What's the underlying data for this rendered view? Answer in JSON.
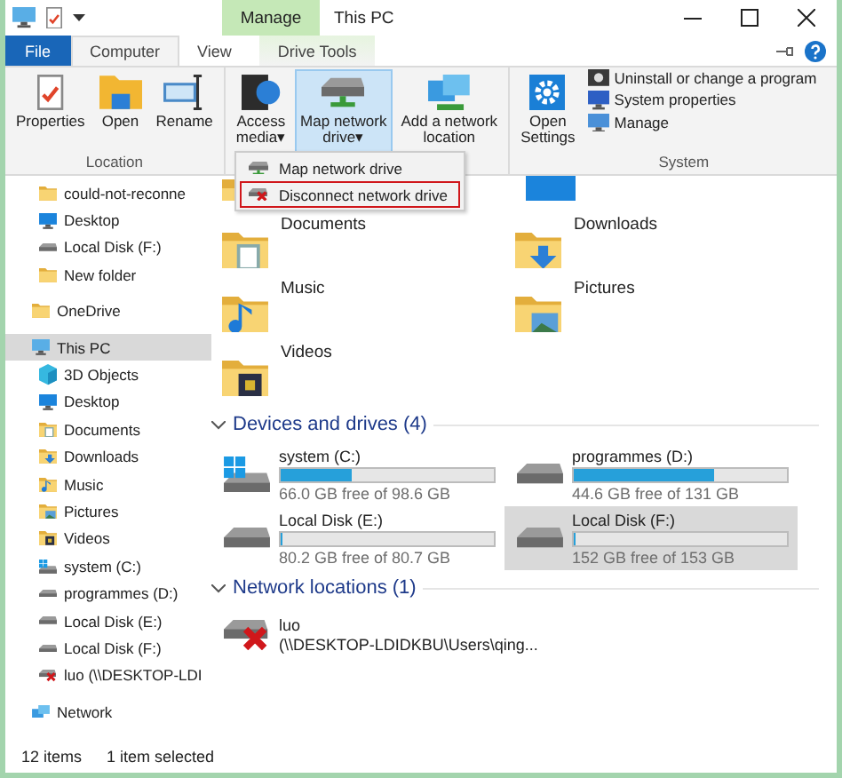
{
  "titlebar": {
    "context_tab": "Manage",
    "title": "This PC"
  },
  "tabs": [
    {
      "label": "File",
      "kind": "file",
      "selected": false
    },
    {
      "label": "Computer",
      "kind": "normal",
      "selected": true
    },
    {
      "label": "View",
      "kind": "normal",
      "selected": false
    },
    {
      "label": "Drive Tools",
      "kind": "context",
      "selected": false
    }
  ],
  "ribbon": {
    "groups": [
      {
        "label": "Location",
        "buttons": [
          {
            "label": "Properties",
            "kind": "properties",
            "pressed": false
          },
          {
            "label": "Open",
            "kind": "open",
            "pressed": false
          },
          {
            "label": "Rename",
            "kind": "rename",
            "pressed": false
          }
        ]
      },
      {
        "buttons": [
          {
            "label": "Access\nmedia",
            "caret": "▾",
            "kind": "media",
            "pressed": false
          },
          {
            "label": "Map network\ndrive",
            "caret": "▾",
            "kind": "map",
            "pressed": true
          },
          {
            "label": "Add a network\nlocation",
            "kind": "addnet",
            "pressed": false
          }
        ]
      },
      {
        "label": "System",
        "buttons": [
          {
            "label": "Open\nSettings",
            "kind": "settings",
            "pressed": false
          }
        ],
        "small_buttons": [
          {
            "label": "Uninstall or change a program",
            "kind": "uninstall"
          },
          {
            "label": "System properties",
            "kind": "sysprops"
          },
          {
            "label": "Manage",
            "kind": "manage"
          }
        ]
      }
    ]
  },
  "menu": {
    "items": [
      {
        "label": "Map network drive",
        "kind": "map",
        "selected": false
      },
      {
        "label": "Disconnect network drive",
        "kind": "disconnect",
        "selected": true
      }
    ]
  },
  "nav": {
    "pinned": [
      {
        "label": "could-not-reconne",
        "kind": "folder",
        "selected": false
      },
      {
        "label": "Desktop",
        "kind": "desktop",
        "selected": false
      },
      {
        "label": "Local Disk (F:)",
        "kind": "drive",
        "selected": false
      },
      {
        "label": "New folder",
        "kind": "folder",
        "selected": false
      }
    ],
    "items": [
      {
        "label": "OneDrive",
        "kind": "folder",
        "selected": false
      },
      {
        "label": "This PC",
        "kind": "pc",
        "selected": true,
        "children": [
          {
            "label": "3D Objects",
            "kind": "cube",
            "selected": false
          },
          {
            "label": "Desktop",
            "kind": "desktop",
            "selected": false
          },
          {
            "label": "Documents",
            "kind": "documents",
            "selected": false
          },
          {
            "label": "Downloads",
            "kind": "downloads",
            "selected": false
          },
          {
            "label": "Music",
            "kind": "music",
            "selected": false
          },
          {
            "label": "Pictures",
            "kind": "pictures",
            "selected": false
          },
          {
            "label": "Videos",
            "kind": "videos",
            "selected": false
          },
          {
            "label": "system (C:)",
            "kind": "system",
            "selected": false
          },
          {
            "label": "programmes (D:)",
            "kind": "drive",
            "selected": false
          },
          {
            "label": "Local Disk (E:)",
            "kind": "drive",
            "selected": false
          },
          {
            "label": "Local Disk (F:)",
            "kind": "drive",
            "selected": false
          },
          {
            "label": "luo (\\\\DESKTOP-LDI",
            "kind": "netdrive",
            "selected": false
          }
        ]
      },
      {
        "label": "Network",
        "kind": "network",
        "selected": false
      }
    ]
  },
  "folders": [
    {
      "label": "Documents",
      "kind": "documents"
    },
    {
      "label": "Downloads",
      "kind": "downloads"
    },
    {
      "label": "Music",
      "kind": "music"
    },
    {
      "label": "Pictures",
      "kind": "pictures"
    },
    {
      "label": "Videos",
      "kind": "videos"
    }
  ],
  "drives_section": {
    "title": "Devices and drives (4)",
    "drives": [
      {
        "name": "system (C:)",
        "kind": "system",
        "level": 0.33,
        "space": "66.0 GB free of 98.6 GB",
        "selected": false
      },
      {
        "name": "programmes (D:)",
        "kind": "drive",
        "level": 0.66,
        "space": "44.6 GB free of 131 GB",
        "selected": false
      },
      {
        "name": "Local Disk (E:)",
        "kind": "drive",
        "level": 0.01,
        "space": "80.2 GB free of 80.7 GB",
        "selected": false
      },
      {
        "name": "Local Disk (F:)",
        "kind": "drive",
        "level": 0.01,
        "space": "152 GB free of 153 GB",
        "selected": true
      }
    ]
  },
  "network_section": {
    "title": "Network locations (1)",
    "locations": [
      {
        "name": "luo",
        "path": "(\\\\DESKTOP-LDIDKBU\\Users\\qing...",
        "kind": "netdrive"
      }
    ]
  },
  "status_bar": {
    "count": "12 items",
    "selection": "1 item selected"
  }
}
